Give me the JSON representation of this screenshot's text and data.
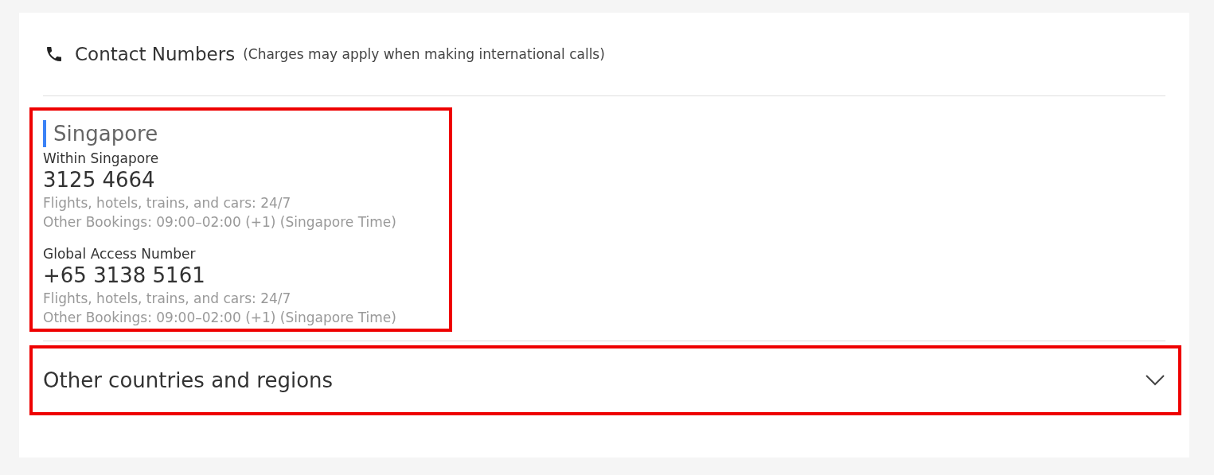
{
  "header": {
    "title": "Contact Numbers",
    "note": "(Charges may apply when making international calls)"
  },
  "region": {
    "name": "Singapore",
    "highlighted": true,
    "numbers": [
      {
        "label": "Within Singapore",
        "number": "3125 4664",
        "hours": [
          "Flights, hotels, trains, and cars: 24/7",
          "Other Bookings: 09:00–02:00 (+1) (Singapore Time)"
        ]
      },
      {
        "label": "Global Access Number",
        "number": "+65 3138 5161",
        "hours": [
          "Flights, hotels, trains, and cars: 24/7",
          "Other Bookings: 09:00–02:00 (+1) (Singapore Time)"
        ]
      }
    ]
  },
  "other": {
    "title": "Other countries and regions",
    "expanded": false,
    "highlighted": true
  }
}
